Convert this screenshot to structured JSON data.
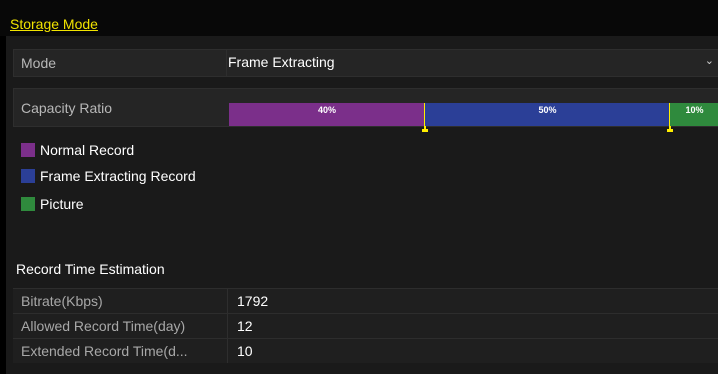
{
  "tab": {
    "label": "Storage Mode"
  },
  "mode": {
    "label": "Mode",
    "value": "Frame Extracting"
  },
  "capacity": {
    "label": "Capacity Ratio",
    "segments": [
      {
        "label": "40%",
        "percent": 40,
        "color": "#7b2f8a"
      },
      {
        "label": "50%",
        "percent": 50,
        "color": "#2b3f97"
      },
      {
        "label": "10%",
        "percent": 10,
        "color": "#2f8a3d"
      }
    ]
  },
  "legend": [
    {
      "label": "Normal Record",
      "color": "#7b2f8a"
    },
    {
      "label": "Frame Extracting Record",
      "color": "#2b3f97"
    },
    {
      "label": "Picture",
      "color": "#2f8a3d"
    }
  ],
  "estimation": {
    "title": "Record Time Estimation",
    "rows": [
      {
        "label": "Bitrate(Kbps)",
        "value": "1792"
      },
      {
        "label": "Allowed Record Time(day)",
        "value": "12"
      },
      {
        "label": "Extended Record Time(d...",
        "value": "10"
      }
    ]
  }
}
